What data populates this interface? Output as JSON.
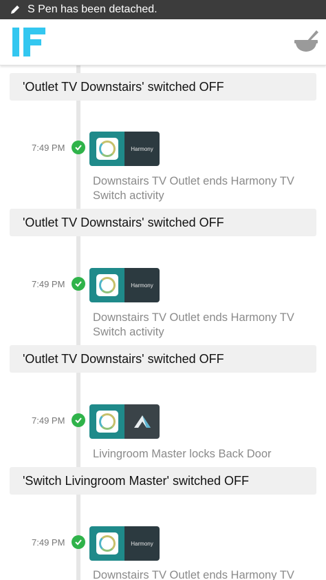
{
  "status_bar": {
    "text": "S Pen has been detached.",
    "icon": "pen-icon",
    "background": "#3c3c3c"
  },
  "app_bar": {
    "logo": "IF",
    "logo_color": "#33c7f0",
    "recipes_icon": "mortar-pestle-icon"
  },
  "feed": [
    {
      "banner": "'Outlet TV Downstairs' switched OFF"
    },
    {
      "time": "7:49 PM",
      "status": "success",
      "trigger_service": "SmartThings",
      "action_service": "Harmony",
      "description": "Downstairs TV Outlet ends Harmony TV Switch activity"
    },
    {
      "banner": "'Outlet TV Downstairs' switched OFF"
    },
    {
      "time": "7:49 PM",
      "status": "success",
      "trigger_service": "SmartThings",
      "action_service": "Harmony",
      "description": "Downstairs TV Outlet ends Harmony TV Switch activity"
    },
    {
      "banner": "'Outlet TV Downstairs' switched OFF"
    },
    {
      "time": "7:49 PM",
      "status": "success",
      "trigger_service": "SmartThings",
      "action_service": "Lockitron",
      "description": "Livingroom Master locks Back Door"
    },
    {
      "banner": "'Switch Livingroom Master' switched OFF"
    },
    {
      "time": "7:49 PM",
      "status": "success",
      "trigger_service": "SmartThings",
      "action_service": "Harmony",
      "description": "Downstairs TV Outlet ends Harmony TV"
    }
  ],
  "colors": {
    "success": "#2fb34a",
    "smartthings_tile": "#1f8a8a",
    "action_tile": "#2c3a40",
    "banner_bg": "#f0f0f0"
  }
}
